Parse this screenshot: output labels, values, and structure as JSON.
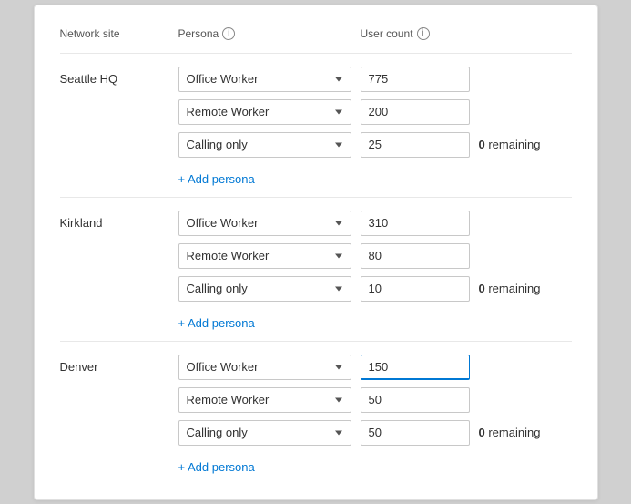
{
  "header": {
    "col_site": "Network site",
    "col_persona": "Persona",
    "col_usercount": "User count"
  },
  "info_icon_label": "i",
  "sites": [
    {
      "id": "seattle-hq",
      "name": "Seattle HQ",
      "personas": [
        {
          "id": "office-worker-1",
          "value": "Office Worker",
          "user_count": "775",
          "active": false
        },
        {
          "id": "remote-worker-1",
          "value": "Remote Worker",
          "user_count": "200",
          "active": false
        },
        {
          "id": "calling-only-1",
          "value": "Calling only",
          "user_count": "25",
          "active": false,
          "show_remaining": true,
          "remaining": "0"
        }
      ],
      "add_persona_label": "+ Add persona"
    },
    {
      "id": "kirkland",
      "name": "Kirkland",
      "personas": [
        {
          "id": "office-worker-2",
          "value": "Office Worker",
          "user_count": "310",
          "active": false
        },
        {
          "id": "remote-worker-2",
          "value": "Remote Worker",
          "user_count": "80",
          "active": false
        },
        {
          "id": "calling-only-2",
          "value": "Calling only",
          "user_count": "10",
          "active": false,
          "show_remaining": true,
          "remaining": "0"
        }
      ],
      "add_persona_label": "+ Add persona"
    },
    {
      "id": "denver",
      "name": "Denver",
      "personas": [
        {
          "id": "office-worker-3",
          "value": "Office Worker",
          "user_count": "150",
          "active": true
        },
        {
          "id": "remote-worker-3",
          "value": "Remote Worker",
          "user_count": "50",
          "active": false
        },
        {
          "id": "calling-only-3",
          "value": "Calling only",
          "user_count": "50",
          "active": false,
          "show_remaining": true,
          "remaining": "0"
        }
      ],
      "add_persona_label": "+ Add persona"
    }
  ],
  "persona_options": [
    "Office Worker",
    "Remote Worker",
    "Calling only"
  ],
  "remaining_suffix": "remaining"
}
